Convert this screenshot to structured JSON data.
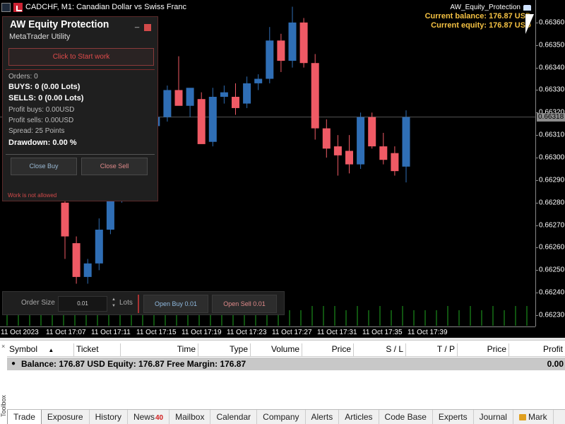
{
  "window": {
    "title": "CADCHF, M1:  Canadian Dollar vs Swiss Franc"
  },
  "ea_info": {
    "name": "AW_Equity_Protection",
    "balance": "Current balance: 176.87 USD",
    "equity": "Current equity: 176.87 USD"
  },
  "price_axis": {
    "labels": [
      "0.66360",
      "0.66350",
      "0.66340",
      "0.66330",
      "0.66320",
      "0.66310",
      "0.66300",
      "0.66290",
      "0.66280",
      "0.66270",
      "0.66260",
      "0.66250",
      "0.66240",
      "0.66230"
    ],
    "current_price": "0.66318"
  },
  "time_axis": {
    "labels": [
      "11 Oct 2023",
      "11 Oct 17:07",
      "11 Oct 17:11",
      "11 Oct 17:15",
      "11 Oct 17:19",
      "11 Oct 17:23",
      "11 Oct 17:27",
      "11 Oct 17:31",
      "11 Oct 17:35",
      "11 Oct 17:39"
    ]
  },
  "chart_data": {
    "type": "candlestick",
    "symbol": "CADCHF",
    "timeframe": "M1",
    "ylim": [
      0.66225,
      0.6637
    ],
    "bull_color": "#2f6eb5",
    "bear_color": "#ef5a65",
    "candles": [
      {
        "o": 0.6628,
        "h": 0.66283,
        "l": 0.66255,
        "c": 0.66265
      },
      {
        "o": 0.66262,
        "h": 0.66265,
        "l": 0.66244,
        "c": 0.66247
      },
      {
        "o": 0.66247,
        "h": 0.66255,
        "l": 0.66244,
        "c": 0.66253
      },
      {
        "o": 0.66253,
        "h": 0.66273,
        "l": 0.6625,
        "c": 0.66268
      },
      {
        "o": 0.66268,
        "h": 0.66284,
        "l": 0.66266,
        "c": 0.66282
      },
      {
        "o": 0.66282,
        "h": 0.663,
        "l": 0.6628,
        "c": 0.66296
      },
      {
        "o": 0.66296,
        "h": 0.66303,
        "l": 0.6629,
        "c": 0.66301
      },
      {
        "o": 0.66301,
        "h": 0.66316,
        "l": 0.66298,
        "c": 0.66314
      },
      {
        "o": 0.66314,
        "h": 0.66322,
        "l": 0.66313,
        "c": 0.66318
      },
      {
        "o": 0.66318,
        "h": 0.66332,
        "l": 0.66316,
        "c": 0.6633
      },
      {
        "o": 0.6633,
        "h": 0.66345,
        "l": 0.66329,
        "c": 0.66323
      },
      {
        "o": 0.66323,
        "h": 0.6633,
        "l": 0.66318,
        "c": 0.66331
      },
      {
        "o": 0.66326,
        "h": 0.66329,
        "l": 0.66318,
        "c": 0.66306
      },
      {
        "o": 0.66307,
        "h": 0.66331,
        "l": 0.66305,
        "c": 0.66327
      },
      {
        "o": 0.66327,
        "h": 0.66332,
        "l": 0.66324,
        "c": 0.66329
      },
      {
        "o": 0.66327,
        "h": 0.66333,
        "l": 0.66319,
        "c": 0.66322
      },
      {
        "o": 0.66324,
        "h": 0.66336,
        "l": 0.66322,
        "c": 0.66333
      },
      {
        "o": 0.66333,
        "h": 0.66337,
        "l": 0.6633,
        "c": 0.66335
      },
      {
        "o": 0.66335,
        "h": 0.66358,
        "l": 0.66333,
        "c": 0.66352
      },
      {
        "o": 0.66352,
        "h": 0.66355,
        "l": 0.66338,
        "c": 0.66343
      },
      {
        "o": 0.66343,
        "h": 0.66367,
        "l": 0.6634,
        "c": 0.6636
      },
      {
        "o": 0.6636,
        "h": 0.66362,
        "l": 0.6634,
        "c": 0.66342
      },
      {
        "o": 0.66342,
        "h": 0.66346,
        "l": 0.66308,
        "c": 0.66313
      },
      {
        "o": 0.66313,
        "h": 0.66317,
        "l": 0.663,
        "c": 0.66304
      },
      {
        "o": 0.66305,
        "h": 0.6631,
        "l": 0.66292,
        "c": 0.66301
      },
      {
        "o": 0.66303,
        "h": 0.6631,
        "l": 0.66293,
        "c": 0.66297
      },
      {
        "o": 0.66297,
        "h": 0.6632,
        "l": 0.66295,
        "c": 0.66318
      },
      {
        "o": 0.66318,
        "h": 0.6632,
        "l": 0.66304,
        "c": 0.66305
      },
      {
        "o": 0.66305,
        "h": 0.66311,
        "l": 0.66297,
        "c": 0.66299
      },
      {
        "o": 0.66302,
        "h": 0.66305,
        "l": 0.66292,
        "c": 0.66294
      },
      {
        "o": 0.66296,
        "h": 0.66321,
        "l": 0.66289,
        "c": 0.66318
      }
    ],
    "volumes": [
      1,
      1,
      1,
      1,
      1,
      2,
      2,
      2,
      2,
      2,
      2,
      3,
      2,
      2,
      3,
      2,
      2,
      3,
      2,
      2,
      2,
      2,
      2,
      3,
      2,
      2,
      2,
      3,
      3,
      3,
      2,
      3,
      2,
      3,
      2,
      3,
      2,
      2,
      2,
      3,
      2,
      3,
      2,
      3,
      2,
      3,
      3,
      3,
      3
    ],
    "volume_color": "#1fa81f"
  },
  "panel": {
    "title": "AW Equity Protection",
    "subtitle": "MetaTrader Utility",
    "start_button": "Click to Start work",
    "orders": "Orders: 0",
    "buys": "BUYS: 0 (0.00 Lots)",
    "sells": "SELLS: 0 (0.00 Lots)",
    "profit_buys": "Profit buys: 0.00USD",
    "profit_sells": "Profit sells: 0.00USD",
    "spread": "Spread: 25 Points",
    "drawdown": "Drawdown: 0.00 %",
    "close_buy": "Close Buy",
    "close_sell": "Close Sell",
    "status": "Work is not allowed"
  },
  "order_bar": {
    "order_size_label": "Order Size",
    "order_size_value": "0.01",
    "lots_label": "Lots",
    "open_buy": "Open Buy 0.01",
    "open_sell": "Open Sell 0.01"
  },
  "toolbox": {
    "side_label": "Toolbox",
    "columns": [
      "Symbol",
      "Ticket",
      "Time",
      "Type",
      "Volume",
      "Price",
      "S / L",
      "T / P",
      "Price",
      "Profit"
    ],
    "balance_line": "Balance: 176.87 USD  Equity: 176.87  Free Margin: 176.87",
    "balance_profit": "0.00",
    "tabs": [
      {
        "label": "Trade"
      },
      {
        "label": "Exposure"
      },
      {
        "label": "History"
      },
      {
        "label": "News",
        "badge": "40"
      },
      {
        "label": "Mailbox"
      },
      {
        "label": "Calendar"
      },
      {
        "label": "Company"
      },
      {
        "label": "Alerts"
      },
      {
        "label": "Articles"
      },
      {
        "label": "Code Base"
      },
      {
        "label": "Experts"
      },
      {
        "label": "Journal"
      },
      {
        "label": "Mark"
      }
    ]
  }
}
